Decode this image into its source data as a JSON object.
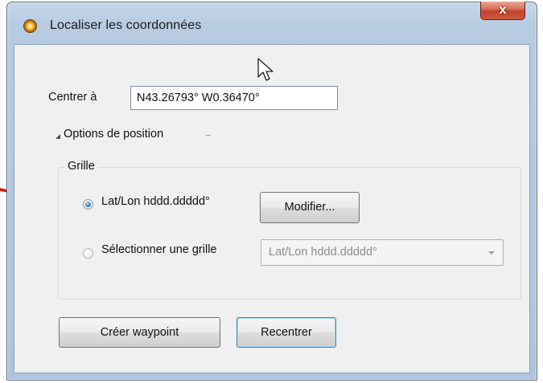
{
  "window": {
    "title": "Localiser les coordonnées",
    "app_icon": "compass-app-icon",
    "close_label": "x"
  },
  "center": {
    "label": "Centrer à",
    "value": "N43.26793° W0.36470°"
  },
  "options": {
    "label": "Options de position",
    "expand_icon": "triangle-expanded-icon"
  },
  "grid": {
    "title": "Grille",
    "option_latlon": {
      "label": "Lat/Lon hddd.ddddd°",
      "selected": true
    },
    "modify_button": "Modifier...",
    "option_select": {
      "label": "Sélectionner une grille",
      "selected": false
    },
    "select_value": "Lat/Lon hddd.ddddd°"
  },
  "buttons": {
    "create_waypoint": "Créer waypoint",
    "recenter": "Recentrer"
  },
  "colors": {
    "annotation_arrow": "#e8100c",
    "close_button": "#c1422b",
    "radio_selected": "#2f87c9"
  }
}
